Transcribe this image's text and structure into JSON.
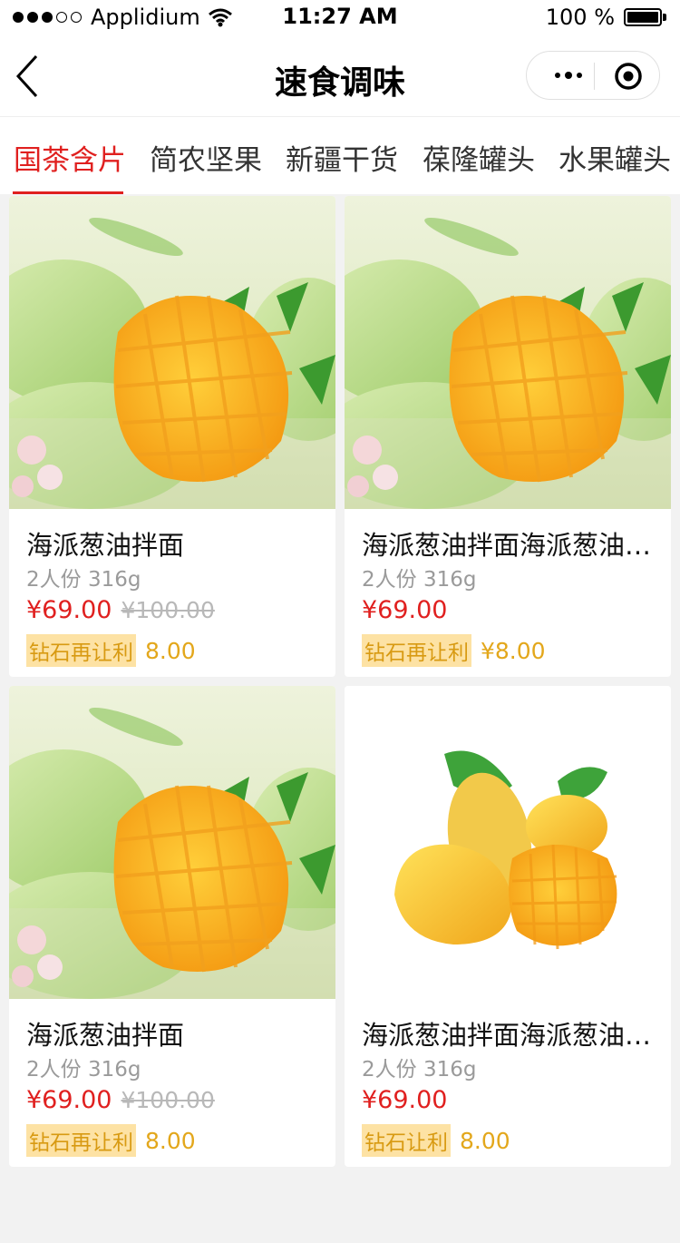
{
  "status_bar": {
    "carrier": "Applidium",
    "time": "11:27 AM",
    "battery": "100 %"
  },
  "nav": {
    "title": "速食调味"
  },
  "tabs": [
    {
      "label": "国茶含片",
      "active": true
    },
    {
      "label": "简农坚果",
      "active": false
    },
    {
      "label": "新疆干货",
      "active": false
    },
    {
      "label": "葆隆罐头",
      "active": false
    },
    {
      "label": "水果罐头",
      "active": false
    }
  ],
  "products": [
    {
      "title": "海派葱油拌面",
      "spec": "2人份 316g",
      "price": "¥69.00",
      "original_price": "¥100.00",
      "badge": "钻石再让利",
      "discount": "8.00",
      "image": "mango-photo-icon"
    },
    {
      "title": "海派葱油拌面海派葱油拌面",
      "spec": "2人份 316g",
      "price": "¥69.00",
      "original_price": "",
      "badge": "钻石再让利",
      "discount": "¥8.00",
      "image": "mango-photo-icon"
    },
    {
      "title": "海派葱油拌面",
      "spec": "2人份 316g",
      "price": "¥69.00",
      "original_price": "¥100.00",
      "badge": "钻石再让利",
      "discount": "8.00",
      "image": "mango-photo-icon"
    },
    {
      "title": "海派葱油拌面海派葱油拌面",
      "spec": "2人份 316g",
      "price": "¥69.00",
      "original_price": "",
      "badge": "钻石让利",
      "discount": "8.00",
      "image": "mango-cutout-icon"
    }
  ]
}
